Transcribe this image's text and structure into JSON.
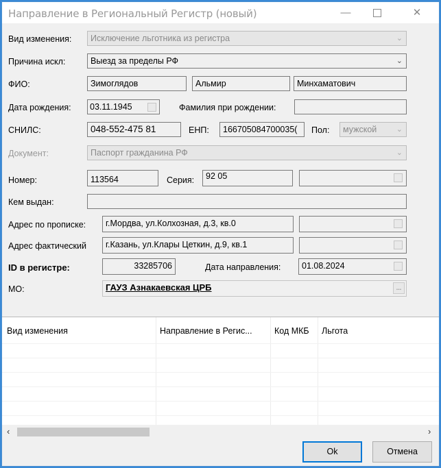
{
  "window": {
    "title": "Направление в Региональный Регистр (новый)",
    "min": "—",
    "close": "✕"
  },
  "form": {
    "change_type": {
      "label": "Вид изменения:",
      "value": "Исключение льготника из регистра"
    },
    "exclusion_reason": {
      "label": "Причина искл:",
      "value": "Выезд за пределы РФ"
    },
    "fio": {
      "label": "ФИО:",
      "last_name": "Зимоглядов",
      "first_name": "Альмир",
      "middle_name": "Минхаматович"
    },
    "birth_date": {
      "label": "Дата рождения:",
      "value": "03.11.1945"
    },
    "birth_surname": {
      "label": "Фамилия при рождении:",
      "value": ""
    },
    "snils": {
      "label": "СНИЛС:",
      "value": "048-552-475 81"
    },
    "enp": {
      "label": "ЕНП:",
      "value": "166705084700035("
    },
    "sex": {
      "label": "Пол:",
      "value": "мужской"
    },
    "document": {
      "label": "Документ:",
      "value": "Паспорт гражданина РФ"
    },
    "number": {
      "label": "Номер:",
      "value": "113564"
    },
    "series": {
      "label": "Серия:",
      "value": "92 05"
    },
    "issued_by": {
      "label": "Кем выдан:",
      "value": ""
    },
    "reg_address": {
      "label": "Адрес по прописке:",
      "value": "г.Мордва, ул.Колхозная, д.3, кв.0"
    },
    "actual_address": {
      "label": "Адрес фактический",
      "value": "г.Казань, ул.Клары Цеткин, д.9, кв.1"
    },
    "registry_id": {
      "label": "ID в регистре:",
      "value": "33285706"
    },
    "referral_date": {
      "label": "Дата направления:",
      "value": "01.08.2024"
    },
    "mo": {
      "label": "МО:",
      "value": "ГАУЗ Азнакаевская ЦРБ"
    }
  },
  "grid": {
    "columns": [
      "Вид изменения",
      "Направление в Регис...",
      "Код МКБ",
      "Льгота"
    ]
  },
  "buttons": {
    "ok": "Ok",
    "cancel": "Отмена"
  },
  "icons": {
    "dropdown": "chevron-down-icon",
    "scroll_left": "chevron-left-icon",
    "scroll_right": "chevron-right-icon"
  }
}
